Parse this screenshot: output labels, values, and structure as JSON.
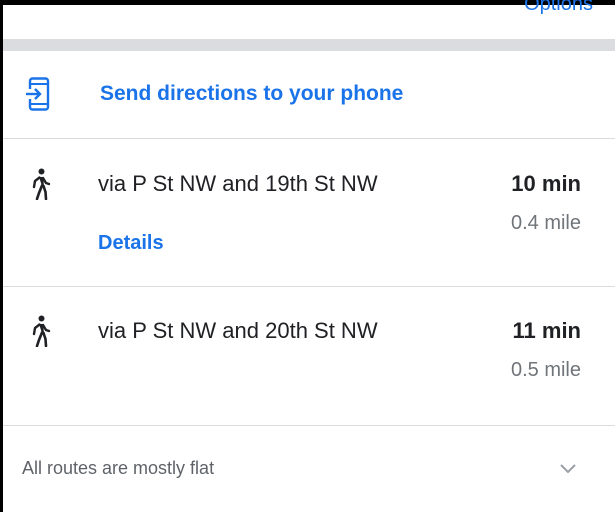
{
  "header": {
    "options_label": "Options"
  },
  "send": {
    "label": "Send directions to your phone"
  },
  "routes": [
    {
      "name": "via P St NW and 19th St NW",
      "duration": "10 min",
      "distance": "0.4 mile",
      "details_label": "Details"
    },
    {
      "name": "via P St NW and 20th St NW",
      "duration": "11 min",
      "distance": "0.5 mile"
    }
  ],
  "terrain": {
    "text": "All routes are mostly flat"
  },
  "icons": {
    "send": "phone-send-icon",
    "walk": "walking-person-icon",
    "expand": "chevron-down-icon"
  },
  "colors": {
    "link": "#1a73e8",
    "text": "#202124",
    "muted": "#70757a",
    "divider": "#dadce0"
  }
}
